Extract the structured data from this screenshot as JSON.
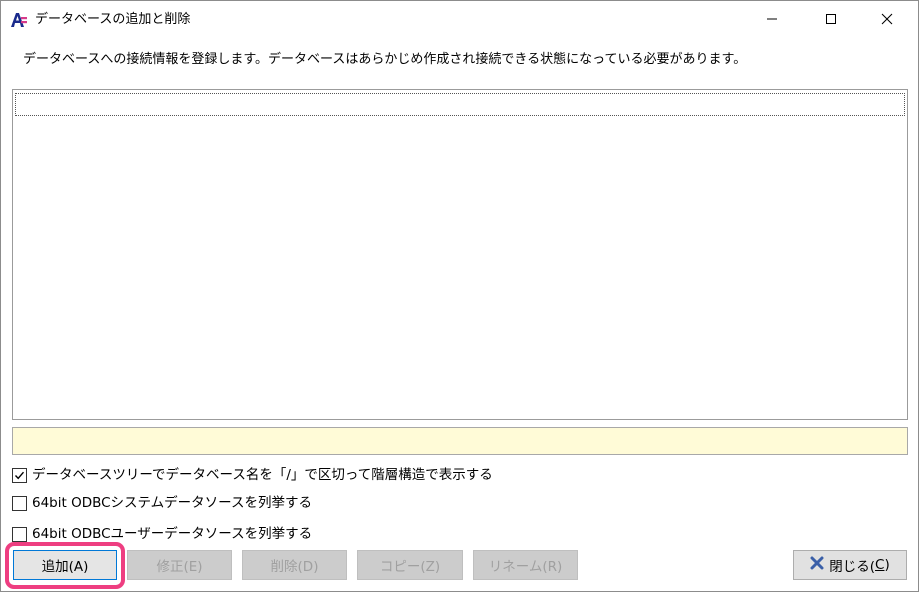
{
  "window": {
    "title": "データベースの追加と削除",
    "app_icon": "app-logo-icon",
    "controls": {
      "minimize_icon": "minimize-icon",
      "maximize_icon": "maximize-icon",
      "close_icon": "close-icon"
    }
  },
  "description": "データベースへの接続情報を登録します。データベースはあらかじめ作成され接続できる状態になっている必要があります。",
  "database_list": {
    "items": []
  },
  "status_text": "",
  "options": {
    "tree_view": {
      "label": "データベースツリーでデータベース名を「/」で区切って階層構造で表示する",
      "checked": true
    },
    "odbc_system_64": {
      "label": "64bit ODBCシステムデータソースを列挙する",
      "checked": false
    },
    "odbc_user_64": {
      "label": "64bit ODBCユーザーデータソースを列挙する",
      "checked": false
    }
  },
  "buttons": {
    "add": "追加(A)",
    "edit": "修正(E)",
    "delete": "削除(D)",
    "copy": "コピー(Z)",
    "rename": "リネーム(R)",
    "close_prefix": "閉じる(",
    "close_key": "C",
    "close_suffix": ")"
  },
  "colors": {
    "highlight": "#ee3e81",
    "status_background": "#fffbd7",
    "default_button_border": "#0078d7"
  }
}
